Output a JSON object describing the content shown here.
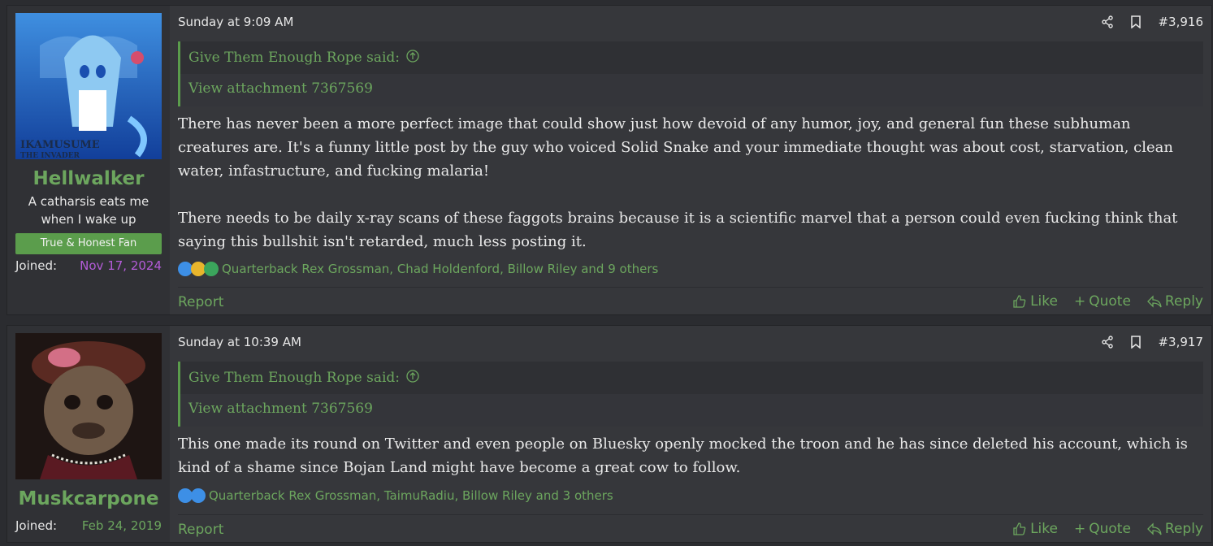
{
  "colors": {
    "accent": "#6ca65e",
    "background": "#36373b",
    "join_date_purple": "#b45cd9"
  },
  "posts": [
    {
      "username": "Hellwalker",
      "user_title_line1": "A catharsis eats me",
      "user_title_line2": "when I wake up",
      "banner": "True & Honest Fan",
      "joined_label": "Joined:",
      "joined_date": "Nov 17, 2024",
      "date": "Sunday at 9:09 AM",
      "post_number": "#3,916",
      "quote_author": "Give Them Enough Rope said:",
      "quote_attachment": "View attachment 7367569",
      "message": [
        "There has never been a more perfect image that could show just how devoid of any humor, joy, and general fun these subhuman creatures are. It's a funny little post by the guy who voiced Solid Snake and your immediate thought was about cost, starvation, clean water, infastructure, and fucking malaria!",
        "There needs to be daily x-ray scans of these faggots brains because it is a scientific marvel that a person could even fucking think that saying this bullshit isn't retarded, much less posting it."
      ],
      "reactions_text": "Quarterback Rex Grossman, Chad Holdenford, Billow Riley and 9 others",
      "reaction_icons": [
        "thumbs-up-icon",
        "winner-icon",
        "check-icon"
      ]
    },
    {
      "username": "Muskcarpone",
      "joined_label": "Joined:",
      "joined_date": "Feb 24, 2019",
      "date": "Sunday at 10:39 AM",
      "post_number": "#3,917",
      "quote_author": "Give Them Enough Rope said:",
      "quote_attachment": "View attachment 7367569",
      "message": [
        "This one made its round on Twitter and even people on Bluesky openly mocked the troon and he has since deleted his account, which is kind of a shame since Bojan Land might have become a great cow to follow."
      ],
      "reactions_text": "Quarterback Rex Grossman, TaimuRadiu, Billow Riley and 3 others",
      "reaction_icons": [
        "informative-icon",
        "thumbs-up-icon"
      ]
    }
  ],
  "footer": {
    "report": "Report",
    "like": "Like",
    "quote": "Quote",
    "reply": "Reply"
  }
}
